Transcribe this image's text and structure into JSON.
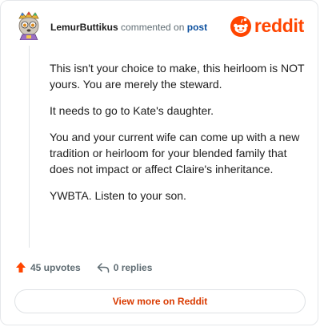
{
  "header": {
    "username": "LemurButtikus",
    "action_text": "commented on",
    "post_link": "post",
    "brand": "reddit"
  },
  "comment": {
    "paragraphs": [
      "This isn't your choice to make, this heirloom is NOT yours. You are merely the steward.",
      "It needs to go to Kate's daughter.",
      "You and your current wife can come up with a new tradition or heirloom for your blended family that does not impact or affect Claire's inheritance.",
      "YWBTA. Listen to your son."
    ]
  },
  "actions": {
    "upvotes": "45 upvotes",
    "replies": "0 replies"
  },
  "footer": {
    "view_more": "View more on Reddit"
  },
  "icons": {
    "avatar": "avatar",
    "brand": "reddit-snoo-icon",
    "upvote": "upvote-arrow-icon",
    "reply": "reply-arrow-icon"
  },
  "colors": {
    "brand": "#ff4500",
    "upvote": "#ff4500",
    "link": "#0b4f9e",
    "view_more": "#d93a00"
  }
}
